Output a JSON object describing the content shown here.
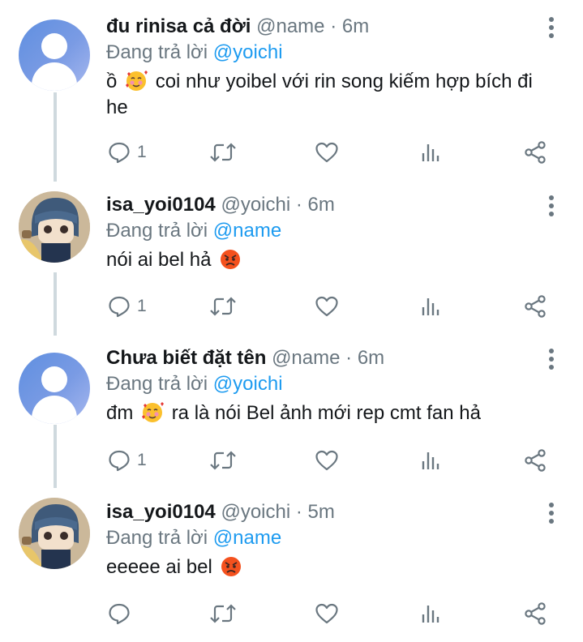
{
  "colors": {
    "accent": "#1d9bf0",
    "muted": "#6a7780",
    "text": "#14171a",
    "thread_line": "#cfd9de"
  },
  "tweets": [
    {
      "display_name": "đu rinisa cả đời",
      "handle": "@name",
      "dot": "·",
      "time": "6m",
      "replying_prefix": "Đang trả lời",
      "replying_to": "@yoichi",
      "text_before_emoji": "ồ",
      "emoji": "smiling-face-with-hearts",
      "text_after_emoji": "coi như yoibel với rin song kiếm hợp bích đi he",
      "reply_count": "1",
      "avatar": "default-avatar"
    },
    {
      "display_name": "isa_yoi0104",
      "handle": "@yoichi",
      "dot": "·",
      "time": "6m",
      "replying_prefix": "Đang trả lời",
      "replying_to": "@name",
      "text_before_emoji": "nói ai bel hả",
      "emoji": "angry-face",
      "text_after_emoji": "",
      "reply_count": "1",
      "avatar": "plush-photo-avatar"
    },
    {
      "display_name": "Chưa biết đặt tên",
      "handle": "@name",
      "dot": "·",
      "time": "6m",
      "replying_prefix": "Đang trả lời",
      "replying_to": "@yoichi",
      "text_before_emoji": "đm",
      "emoji": "smiling-face-with-hearts",
      "text_after_emoji": "ra là nói Bel ảnh mới rep cmt fan hả",
      "reply_count": "1",
      "avatar": "default-avatar"
    },
    {
      "display_name": "isa_yoi0104",
      "handle": "@yoichi",
      "dot": "·",
      "time": "5m",
      "replying_prefix": "Đang trả lời",
      "replying_to": "@name",
      "text_before_emoji": "eeeee ai bel",
      "emoji": "angry-face",
      "text_after_emoji": "",
      "reply_count": "",
      "avatar": "plush-photo-avatar"
    }
  ],
  "icons": {
    "reply": "reply-bubble-icon",
    "retweet": "retweet-icon",
    "like": "heart-icon",
    "views": "bar-chart-icon",
    "share": "share-icon",
    "more": "more-vertical-icon"
  }
}
